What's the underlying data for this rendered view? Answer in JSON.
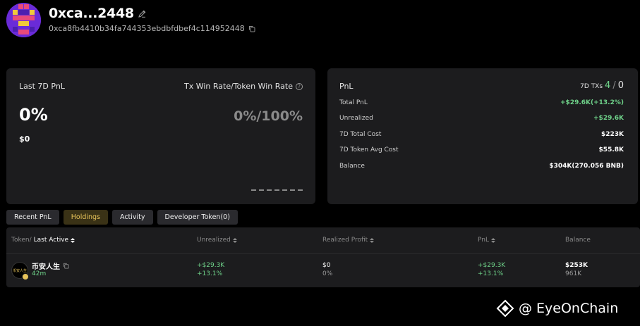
{
  "header": {
    "wallet_name": "0xca...2448",
    "wallet_address": "0xca8fb4410b34fa744353ebdbfdbef4c114952448"
  },
  "left_card": {
    "pnl_label": "Last 7D PnL",
    "winrate_label": "Tx Win Rate/Token Win Rate",
    "pnl_percent": "0%",
    "pnl_usd": "$0",
    "winrate_value": "0%/100%"
  },
  "right_card": {
    "title": "PnL",
    "txs_label": "7D TXs",
    "txs_win": "4",
    "txs_sep": "/",
    "txs_loss": "0",
    "stats": [
      {
        "label": "Total PnL",
        "value": "+$29.6K(+13.2%)",
        "color": "#6fd38a"
      },
      {
        "label": "Unrealized",
        "value": "+$29.6K",
        "color": "#6fd38a"
      },
      {
        "label": "7D Total Cost",
        "value": "$223K",
        "color": "#ffffff"
      },
      {
        "label": "7D Token Avg Cost",
        "value": "$55.8K",
        "color": "#ffffff"
      },
      {
        "label": "Balance",
        "value": "$304K(270.056 BNB)",
        "color": "#ffffff"
      }
    ]
  },
  "tabs": [
    {
      "label": "Recent PnL",
      "active": false
    },
    {
      "label": "Holdings",
      "active": true
    },
    {
      "label": "Activity",
      "active": false
    },
    {
      "label": "Developer Token(0)",
      "active": false
    }
  ],
  "table": {
    "headers": {
      "token_prefix": "Token/",
      "last_active": "Last Active",
      "unrealized": "Unrealized",
      "realized": "Realized Profit",
      "pnl": "PnL",
      "balance": "Balance"
    },
    "row": {
      "token_name": "币安人生",
      "token_logo_text": "币安人生",
      "age": "42m",
      "unrealized_usd": "+$29.3K",
      "unrealized_pct": "+13.1%",
      "realized_usd": "$0",
      "realized_pct": "0%",
      "pnl_usd": "+$29.3K",
      "pnl_pct": "+13.1%",
      "balance_usd": "$253K",
      "balance_amount": "961K"
    }
  },
  "watermark": {
    "text": "@ EyeOnChain"
  },
  "colors": {
    "green": "#6fd38a",
    "accent_gold": "#e8c45a",
    "card_bg": "#1c1c1e"
  }
}
